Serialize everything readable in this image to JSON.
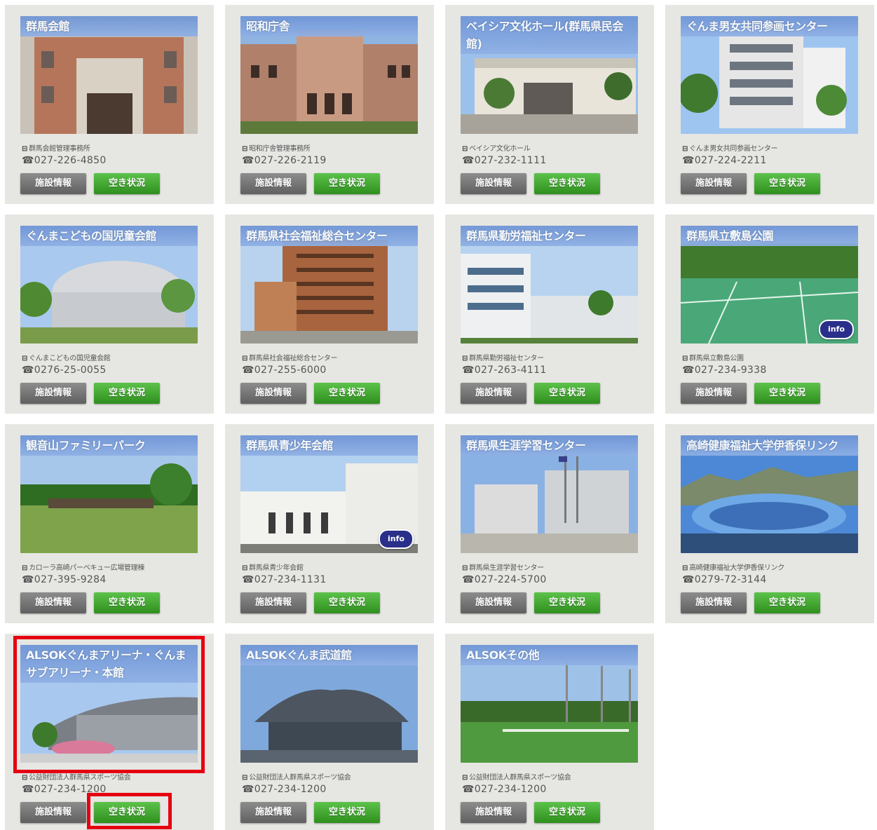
{
  "buttons": {
    "facility_info": "施設情報",
    "availability": "空き状況"
  },
  "info_badge_label": "info",
  "colors": {
    "title_bar": "#7ea2dd",
    "availability_button": "#3ea52b",
    "info_button": "#777777",
    "card_bg": "#e6e6e2",
    "highlight": "#e60012"
  },
  "icons": {
    "building": "building-icon",
    "phone": "phone-icon"
  },
  "facilities": [
    {
      "title": "群馬会館",
      "owner": "群馬会館管理事務所",
      "phone": "027-226-4850",
      "info_badge": false,
      "scene": "classic-brick"
    },
    {
      "title": "昭和庁舎",
      "owner": "昭和庁舎管理事務所",
      "phone": "027-226-2119",
      "info_badge": false,
      "scene": "classic-wide"
    },
    {
      "title": "ベイシア文化ホール(群馬県民会館)",
      "owner": "ベイシア文化ホール",
      "phone": "027-232-1111",
      "info_badge": false,
      "scene": "modern-low"
    },
    {
      "title": "ぐんま男女共同参画センター",
      "owner": "ぐんま男女共同参画センター",
      "phone": "027-224-2211",
      "info_badge": false,
      "scene": "modern-tall"
    },
    {
      "title": "ぐんまこどもの国児童会館",
      "owner": "ぐんまこどもの国児童会館",
      "phone": "0276-25-0055",
      "info_badge": false,
      "scene": "curved-hall"
    },
    {
      "title": "群馬県社会福祉総合センター",
      "owner": "群馬県社会福祉総合センター",
      "phone": "027-255-6000",
      "info_badge": false,
      "scene": "brick-tower"
    },
    {
      "title": "群馬県勤労福祉センター",
      "owner": "群馬県勤労福祉センター",
      "phone": "027-263-4111",
      "info_badge": false,
      "scene": "white-building"
    },
    {
      "title": "群馬県立敷島公園",
      "owner": "群馬県立敷島公園",
      "phone": "027-234-9338",
      "info_badge": true,
      "scene": "tennis"
    },
    {
      "title": "観音山ファミリーパーク",
      "owner": "カローラ高崎パーベキュー広場管理棟",
      "phone": "027-395-9284",
      "info_badge": false,
      "scene": "park"
    },
    {
      "title": "群馬県青少年会館",
      "owner": "群馬県青少年会館",
      "phone": "027-234-1131",
      "info_badge": true,
      "scene": "white-hall"
    },
    {
      "title": "群馬県生涯学習センター",
      "owner": "群馬県生涯学習センター",
      "phone": "027-224-5700",
      "info_badge": false,
      "scene": "plaza"
    },
    {
      "title": "高崎健康福祉大学伊香保リンク",
      "owner": "高崎健康福祉大学伊香保リンク",
      "phone": "0279-72-3144",
      "info_badge": false,
      "scene": "rink"
    },
    {
      "title": "ALSOKぐんまアリーナ・ぐんまサブアリーナ・本館",
      "owner": "公益財団法人群馬県スポーツ協会",
      "phone": "027-234-1200",
      "info_badge": false,
      "scene": "arena"
    },
    {
      "title": "ALSOKぐんま武道館",
      "owner": "公益財団法人群馬県スポーツ協会",
      "phone": "027-234-1200",
      "info_badge": false,
      "scene": "budokan"
    },
    {
      "title": "ALSOKその他",
      "owner": "公益財団法人群馬県スポーツ協会",
      "phone": "027-234-1200",
      "info_badge": false,
      "scene": "sports-field"
    }
  ]
}
